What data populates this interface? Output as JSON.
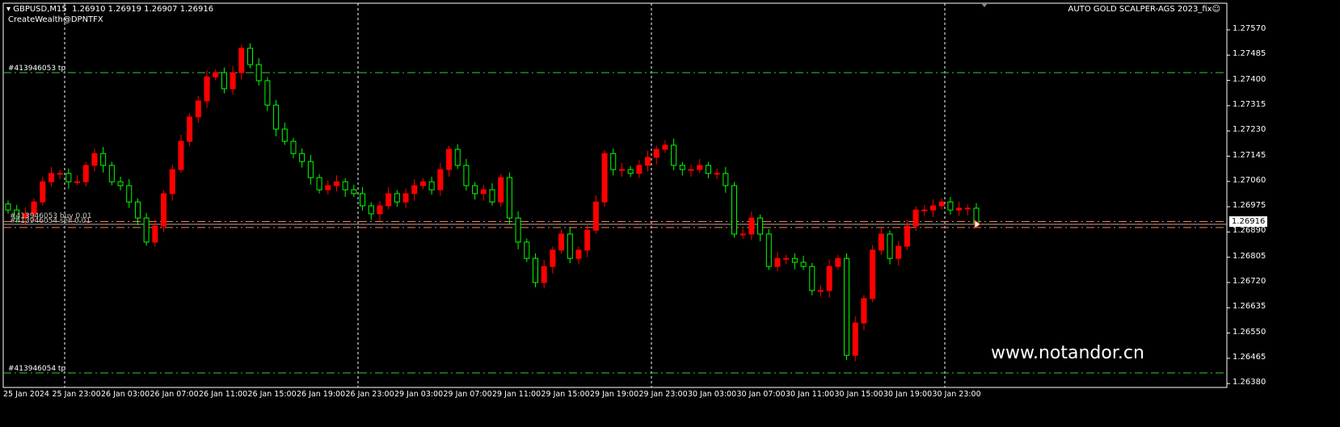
{
  "header": {
    "symbol": "GBPUSD,M15",
    "ohlc": "1.26910 1.26919 1.26907 1.26916",
    "subtitle": "CreateWealth@DPNTFX",
    "expert": "AUTO GOLD SCALPER-AGS 2023_fix☺"
  },
  "orders": {
    "tp_top": "#413946053 tp",
    "tp_bottom": "#413946054 tp",
    "buy": "#413946053 buy 0.01",
    "sell": "#413946054 sell 0.01"
  },
  "watermark": "www.notandor.cn",
  "current_price": "1.26916",
  "colors": {
    "up": "#ff0000",
    "down": "#00ff00",
    "tp": "#33cc33",
    "order": "#ff7f3f",
    "grid": "#ffffff"
  },
  "chart_data": {
    "type": "candlestick",
    "symbol": "GBPUSD",
    "timeframe": "M15",
    "ylim": [
      1.2635,
      1.2764
    ],
    "yticks": [
      "1.27570",
      "1.27485",
      "1.27400",
      "1.27315",
      "1.27230",
      "1.27145",
      "1.27060",
      "1.26975",
      "1.26890",
      "1.26805",
      "1.26720",
      "1.26635",
      "1.26550",
      "1.26465",
      "1.26380"
    ],
    "xticks": [
      "25 Jan 2024",
      "25 Jan 23:00",
      "26 Jan 03:00",
      "26 Jan 07:00",
      "26 Jan 11:00",
      "26 Jan 15:00",
      "26 Jan 19:00",
      "26 Jan 23:00",
      "29 Jan 03:00",
      "29 Jan 07:00",
      "29 Jan 11:00",
      "29 Jan 15:00",
      "29 Jan 19:00",
      "29 Jan 23:00",
      "30 Jan 03:00",
      "30 Jan 07:00",
      "30 Jan 11:00",
      "30 Jan 15:00",
      "30 Jan 19:00",
      "30 Jan 23:00"
    ],
    "closes": [
      1.26964,
      1.26937,
      1.26951,
      1.26991,
      1.27059,
      1.27087,
      1.27087,
      1.27059,
      1.27059,
      1.27114,
      1.27154,
      1.27114,
      1.27059,
      1.27046,
      1.26991,
      1.26937,
      1.26856,
      1.2691,
      1.27019,
      1.271,
      1.27195,
      1.27277,
      1.27331,
      1.27412,
      1.27426,
      1.27372,
      1.27426,
      1.27508,
      1.27453,
      1.27399,
      1.27317,
      1.27236,
      1.27195,
      1.27154,
      1.27127,
      1.27073,
      1.27032,
      1.27046,
      1.27059,
      1.27032,
      1.27019,
      1.26978,
      1.26951,
      1.26978,
      1.27019,
      1.26991,
      1.27019,
      1.27046,
      1.27059,
      1.27032,
      1.271,
      1.27168,
      1.27114,
      1.27046,
      1.27019,
      1.27032,
      1.26991,
      1.27073,
      1.26937,
      1.26856,
      1.26801,
      1.2672,
      1.26774,
      1.26829,
      1.26883,
      1.26801,
      1.26829,
      1.26896,
      1.26991,
      1.27154,
      1.271,
      1.271,
      1.27087,
      1.27114,
      1.27141,
      1.27168,
      1.27182,
      1.27114,
      1.271,
      1.271,
      1.27114,
      1.27087,
      1.27087,
      1.27046,
      1.26883,
      1.26883,
      1.26937,
      1.26883,
      1.26774,
      1.26801,
      1.26801,
      1.26788,
      1.26774,
      1.26693,
      1.26693,
      1.26774,
      1.26801,
      1.26475,
      1.26584,
      1.26666,
      1.26829,
      1.26883,
      1.26801,
      1.26842,
      1.2691,
      1.26964,
      1.26964,
      1.26978,
      1.26991,
      1.26964,
      1.2697,
      1.2697,
      1.26916
    ],
    "tp_levels": [
      1.27426,
      1.26416
    ],
    "order_levels": [
      1.26925,
      1.26905
    ],
    "current": 1.26916
  }
}
